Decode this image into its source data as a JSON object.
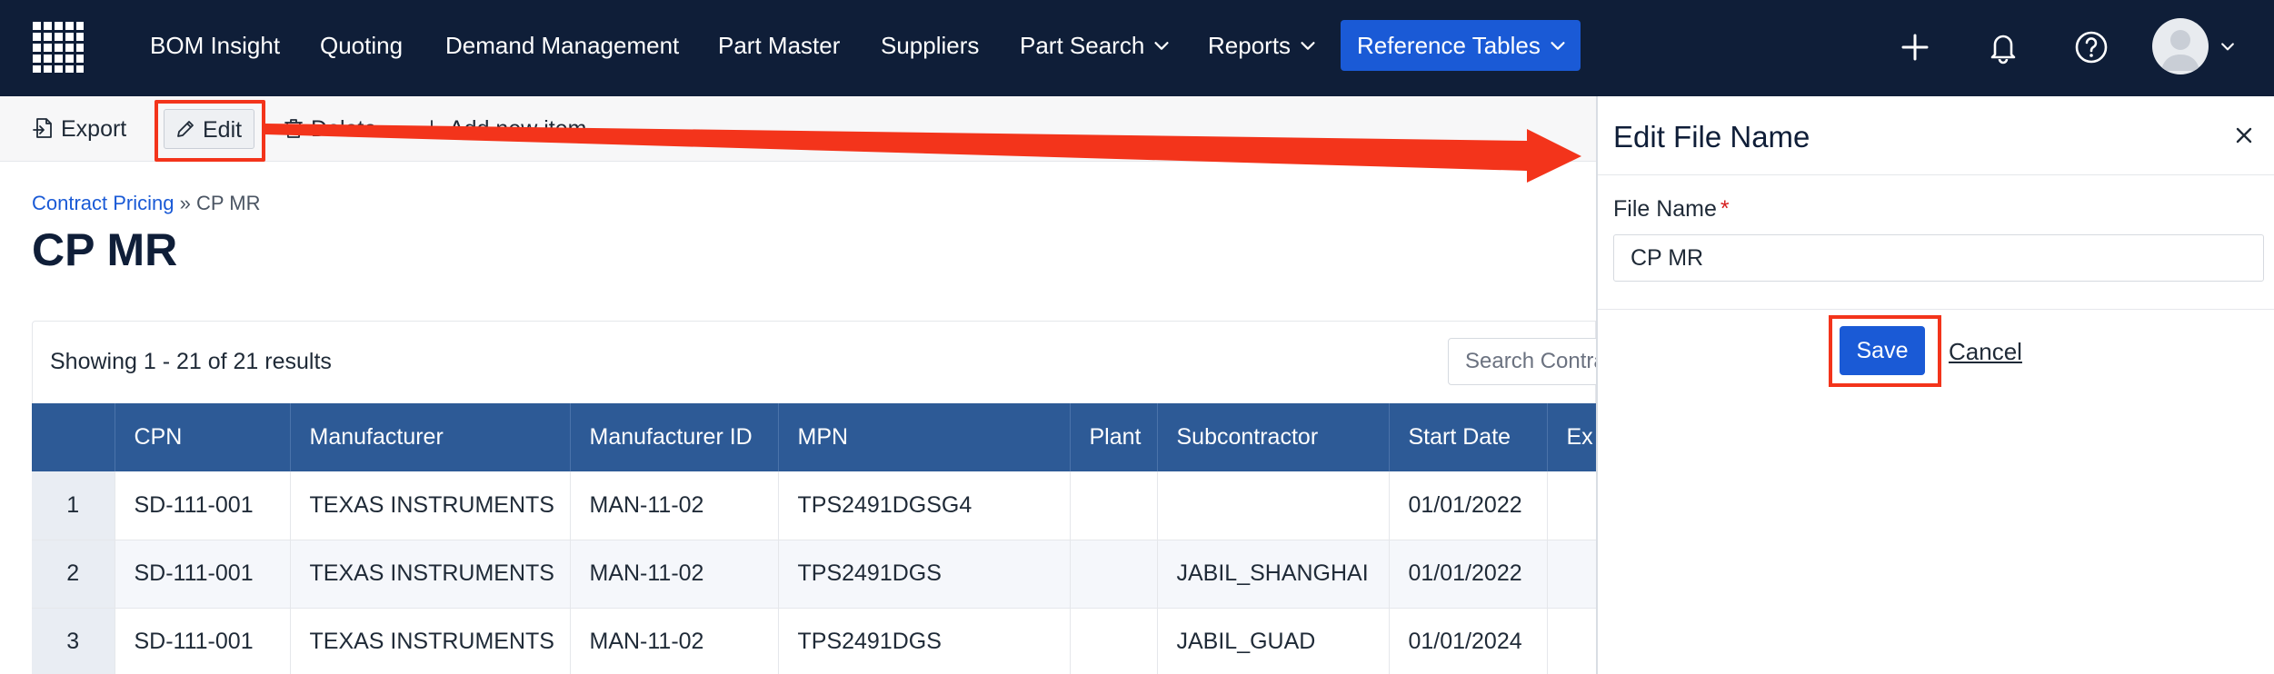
{
  "nav": {
    "items": [
      {
        "label": "BOM Insight",
        "has_dropdown": false
      },
      {
        "label": "Quoting",
        "has_dropdown": false
      },
      {
        "label": "Demand Management",
        "has_dropdown": false
      },
      {
        "label": "Part Master",
        "has_dropdown": false
      },
      {
        "label": "Suppliers",
        "has_dropdown": false
      },
      {
        "label": "Part Search",
        "has_dropdown": true
      },
      {
        "label": "Reports",
        "has_dropdown": true
      }
    ],
    "active_item": {
      "label": "Reference Tables",
      "has_dropdown": true
    },
    "icons": [
      "grid-logo-icon",
      "plus-icon",
      "bell-icon",
      "help-icon",
      "user-avatar-icon",
      "chevron-down-icon"
    ],
    "accent_color": "#1a5ad6",
    "background_color": "#0f1e38"
  },
  "toolbar": {
    "export_label": "Export",
    "edit_label": "Edit",
    "delete_label": "Delete",
    "add_label": "Add new item"
  },
  "breadcrumb": {
    "parent": "Contract Pricing",
    "separator": "»",
    "current": "CP MR"
  },
  "page": {
    "title": "CP MR"
  },
  "results": {
    "summary": "Showing 1 - 21 of 21 results",
    "search_placeholder": "Search Contract Pricing"
  },
  "table": {
    "headers": [
      "",
      "CPN",
      "Manufacturer",
      "Manufacturer ID",
      "MPN",
      "Plant",
      "Subcontractor",
      "Start Date",
      "Ex"
    ],
    "rows": [
      {
        "index": "1",
        "cpn": "SD-111-001",
        "manufacturer": "TEXAS INSTRUMENTS",
        "manufacturer_id": "MAN-11-02",
        "mpn": "TPS2491DGSG4",
        "plant": "",
        "subcontractor": "",
        "start_date": "01/01/2022",
        "extra": ""
      },
      {
        "index": "2",
        "cpn": "SD-111-001",
        "manufacturer": "TEXAS INSTRUMENTS",
        "manufacturer_id": "MAN-11-02",
        "mpn": "TPS2491DGS",
        "plant": "",
        "subcontractor": "JABIL_SHANGHAI",
        "start_date": "01/01/2022",
        "extra": ""
      },
      {
        "index": "3",
        "cpn": "SD-111-001",
        "manufacturer": "TEXAS INSTRUMENTS",
        "manufacturer_id": "MAN-11-02",
        "mpn": "TPS2491DGS",
        "plant": "",
        "subcontractor": "JABIL_GUAD",
        "start_date": "01/01/2024",
        "extra": ""
      }
    ],
    "header_color": "#2d5a96"
  },
  "panel": {
    "title": "Edit File Name",
    "field_label": "File Name",
    "required_mark": "*",
    "field_value": "CP MR",
    "save_label": "Save",
    "cancel_label": "Cancel"
  },
  "annotation": {
    "highlight_color": "#f3341b"
  }
}
